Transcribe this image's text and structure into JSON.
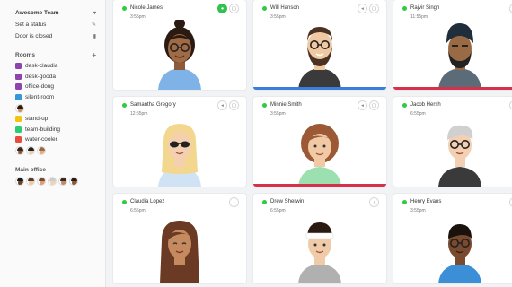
{
  "sidebar": {
    "team_name": "Awesome Team",
    "set_status": "Set a status",
    "door_status": "Door is closed",
    "rooms_label": "Rooms",
    "rooms": [
      {
        "label": "desk-claudia",
        "color": "#8e44ad"
      },
      {
        "label": "desk-gooda",
        "color": "#8e44ad"
      },
      {
        "label": "office-doug",
        "color": "#8e44ad"
      },
      {
        "label": "silent-room",
        "color": "#3498db"
      },
      {
        "label": "stand-up",
        "color": "#f1c40f"
      },
      {
        "label": "team-building",
        "color": "#2ecc71"
      },
      {
        "label": "water-cooler",
        "color": "#e74c3c"
      }
    ],
    "main_office_label": "Main office"
  },
  "people": [
    {
      "name": "Nicole James",
      "time": "3:55pm",
      "accent": "",
      "icons": [
        "mic",
        "video"
      ]
    },
    {
      "name": "Will Hanson",
      "time": "3:55pm",
      "accent": "#3b7dd8",
      "icons": [
        "mic",
        "video"
      ]
    },
    {
      "name": "Rajvir Singh",
      "time": "11:55pm",
      "accent": "#d6304a",
      "icons": [
        "mic"
      ]
    },
    {
      "name": "Samantha Gregory",
      "time": "12:55pm",
      "accent": "",
      "icons": [
        "mic",
        "video"
      ]
    },
    {
      "name": "Minnie Smith",
      "time": "3:55pm",
      "accent": "#d6304a",
      "icons": [
        "mic",
        "video"
      ]
    },
    {
      "name": "Jacob Hersh",
      "time": "6:55pm",
      "accent": "",
      "icons": [
        "mic"
      ]
    },
    {
      "name": "Claudia Lopez",
      "time": "6:55pm",
      "accent": "",
      "icons": [
        "chevron"
      ]
    },
    {
      "name": "Drew Sherwin",
      "time": "6:55pm",
      "accent": "",
      "icons": [
        "chevron"
      ]
    },
    {
      "name": "Henry Evans",
      "time": "3:55pm",
      "accent": "",
      "icons": [
        "chevron"
      ]
    }
  ]
}
